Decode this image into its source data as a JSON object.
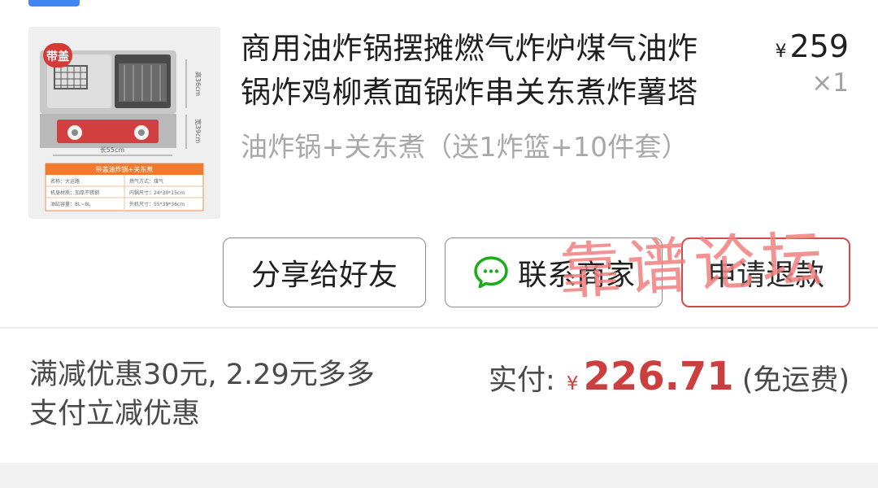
{
  "product": {
    "title_line1": "商用油炸锅摆摊燃气炸炉煤气油炸",
    "title_line2": "锅炸鸡柳煮面锅炸串关东煮炸薯塔",
    "price_currency": "¥",
    "price_amount": "259",
    "quantity": "×1",
    "variant": "油炸锅+关东煮（送1炸篮+10件套）",
    "image": {
      "badge": "带盖",
      "panel_title": "带盖油炸锅+关东煮",
      "spec_rows": [
        [
          "名称：大运路",
          "燃气方式：煤气"
        ],
        [
          "机身材质：加厚不锈钢",
          "内锅尺寸：24*30*15cm"
        ],
        [
          "油缸容量：8L~8L",
          "外机尺寸：55*39*36cm"
        ]
      ],
      "dimension_right_top": "高36cm",
      "dimension_right_bottom": "宽39cm",
      "dimension_bottom": "长55cm"
    }
  },
  "actions": {
    "share_label": "分享给好友",
    "contact_label": "联系商家",
    "refund_label": "申请退款"
  },
  "watermark": {
    "text": "靠谱论坛"
  },
  "summary": {
    "promo_line1": "满减优惠30元, 2.29元多多",
    "promo_line2": "支付立减优惠",
    "pay_label": "实付:",
    "pay_currency": "¥",
    "pay_amount": "226.71",
    "pay_shipping": "(免运费)"
  },
  "icons": {
    "contact": "wechat-icon"
  },
  "colors": {
    "accent_red": "#cc3f3f",
    "top_chip_blue": "#3f86f2",
    "wechat_green": "#1aad19"
  }
}
